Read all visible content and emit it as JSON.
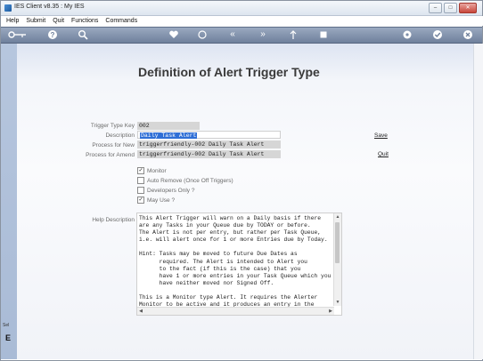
{
  "window": {
    "title": "IES Client v8.35 : My IES"
  },
  "menu": [
    "Help",
    "Submit",
    "Quit",
    "Functions",
    "Commands"
  ],
  "toolbar_icons": [
    "key-icon",
    "help-icon",
    "search-icon",
    "heart-icon",
    "refresh-icon",
    "first-icon",
    "last-icon",
    "up-icon",
    "stop-icon",
    "settings-icon",
    "check-icon",
    "close-icon"
  ],
  "page": {
    "title": "Definition of Alert Trigger Type"
  },
  "form": {
    "labels": {
      "key": "Trigger Type Key",
      "description": "Description",
      "process_new": "Process for New",
      "process_amend": "Process for Amend",
      "help": "Help Description"
    },
    "values": {
      "key": "002",
      "description": "Daily Task Alert",
      "process_new": "triggerfriendly-002 Daily Task Alert",
      "process_amend": "triggerfriendly-002 Daily Task Alert"
    }
  },
  "actions": {
    "save": "Save",
    "quit": "Quit"
  },
  "checkboxes": [
    {
      "label": "Monitor",
      "checked": true
    },
    {
      "label": "Auto Remove (Once Off Triggers)",
      "checked": false
    },
    {
      "label": "Developers Only ?",
      "checked": false
    },
    {
      "label": "May Use ?",
      "checked": true
    }
  ],
  "help_text": "This Alert Trigger will warn on a Daily basis if there\nare any Tasks in your Queue due by TODAY or before.\nThe Alert is not per entry, but rather per Task Queue,\ni.e. will alert once for 1 or more Entries due by Today.\n\nHint: Tasks may be moved to future Due Dates as\n      required. The Alert is intended to Alert you\n      to the fact (if this is the case) that you\n      have 1 or more entries in your Task Queue which you\n      have neither moved nor Signed Off.\n\nThis is a Monitor type Alert. It requires the Alerter\nMonitor to be active and it produces an entry in the",
  "side": {
    "label": "Sel",
    "letter": "E"
  }
}
